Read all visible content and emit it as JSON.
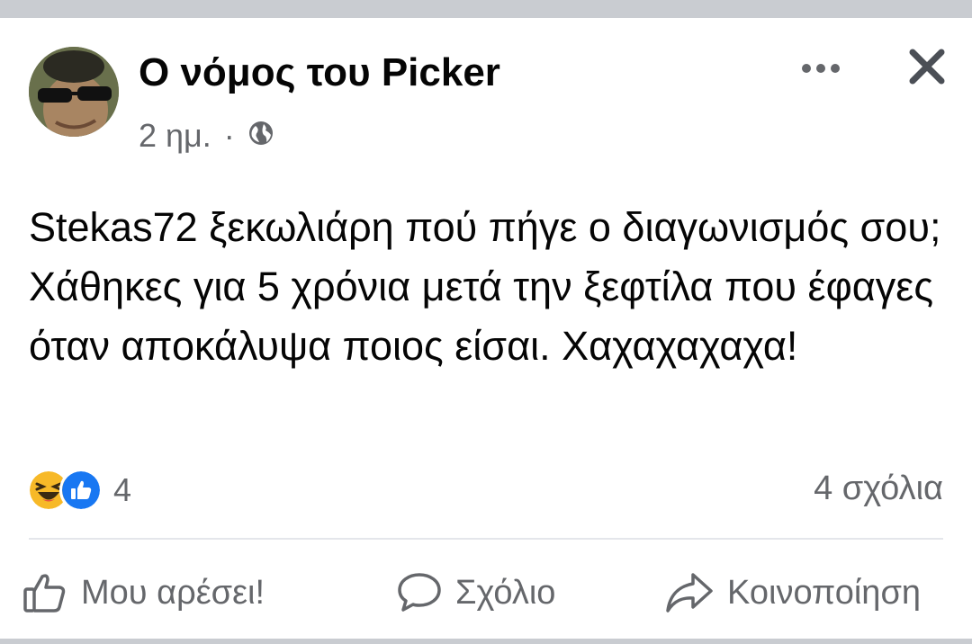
{
  "post": {
    "author": "Ο νόμος του Picker",
    "timestamp": "2 ημ.",
    "separator": "·",
    "privacy_icon": "globe-icon",
    "text": "Stekas72 ξεκωλιάρη πού πήγε ο διαγωνισμός σου; Χάθηκες για 5 χρόνια μετά την ξεφτίλα που έφαγες όταν αποκάλυψα ποιος είσαι. Χαχαχαχαχα!",
    "reaction_icons": [
      "haha-icon",
      "like-icon"
    ],
    "reaction_count": "4",
    "comments_count": "4 σχόλια"
  },
  "header": {
    "more_icon": "more-horizontal-icon",
    "close_icon": "close-icon"
  },
  "actions": {
    "like_label": "Μου αρέσει!",
    "comment_label": "Σχόλιο",
    "share_label": "Κοινοποίηση"
  },
  "colors": {
    "text_primary": "#050505",
    "text_secondary": "#65676b",
    "like_blue": "#1877f2",
    "haha_yellow": "#f7b928",
    "divider": "#e4e6eb",
    "outer_background": "#c9ccd1"
  }
}
